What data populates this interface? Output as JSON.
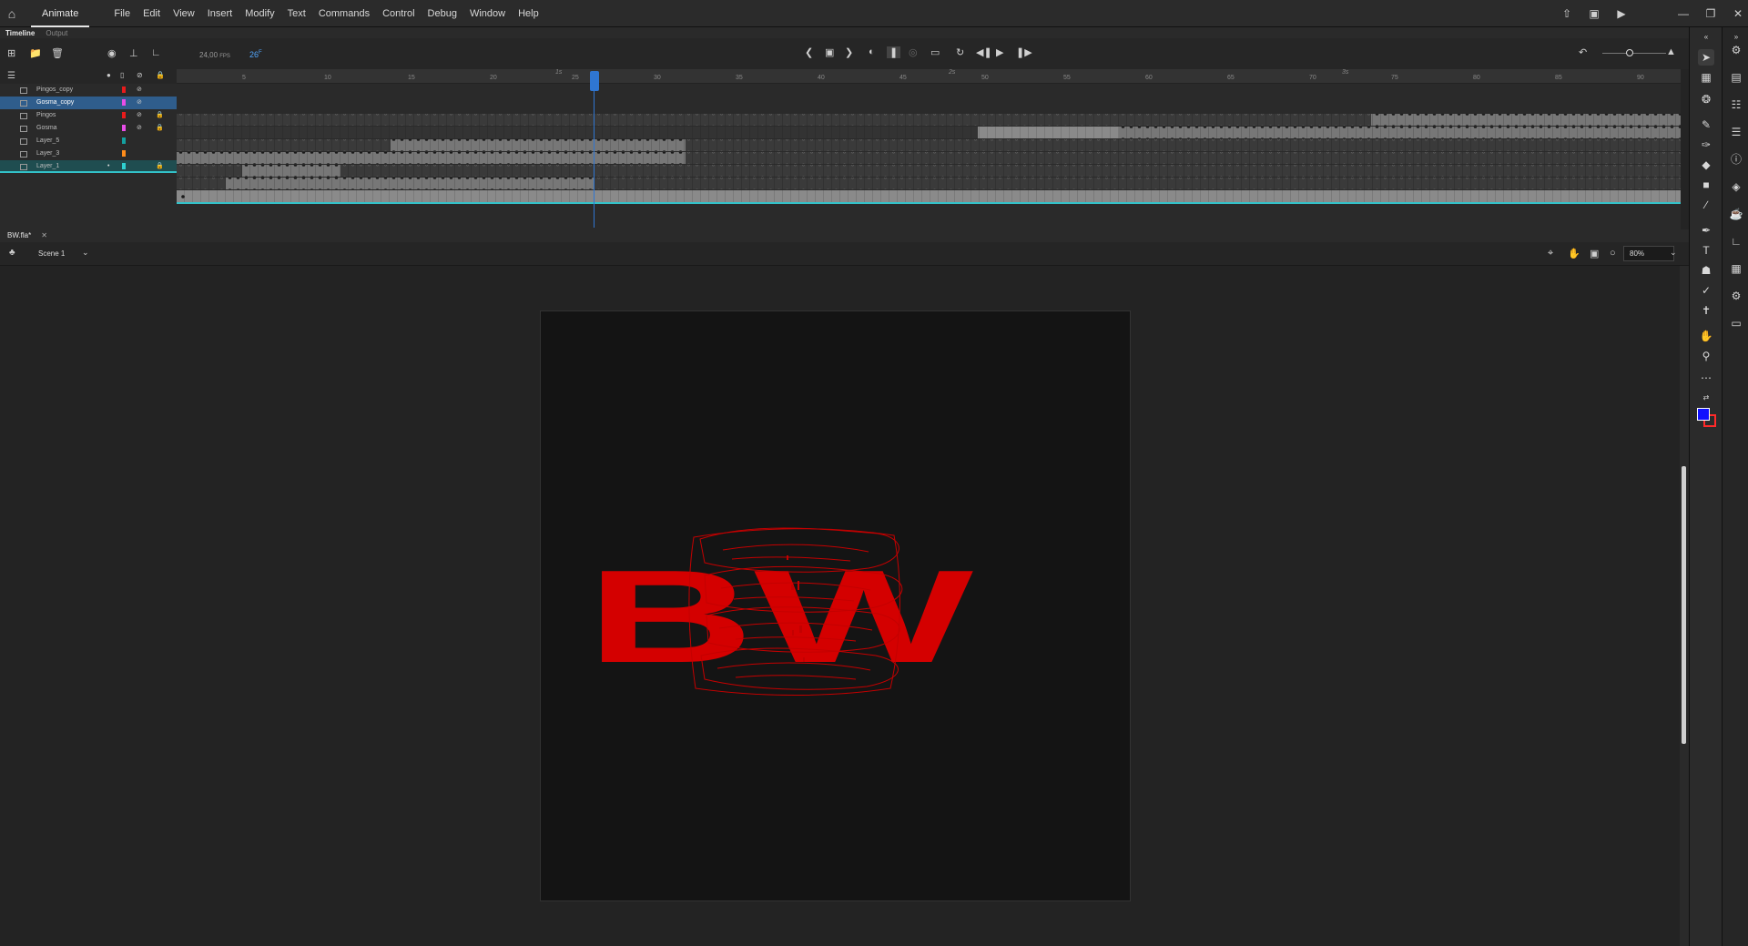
{
  "app": {
    "name": "Animate",
    "menus": [
      "File",
      "Edit",
      "View",
      "Insert",
      "Modify",
      "Text",
      "Commands",
      "Control",
      "Debug",
      "Window",
      "Help"
    ]
  },
  "timeline": {
    "tabs": [
      "Timeline",
      "Output"
    ],
    "fps": "24,00",
    "fps_unit": "FPS",
    "current_frame": "26",
    "frame_unit": "F",
    "ruler_labels": [
      "5",
      "10",
      "15",
      "20",
      "25",
      "30",
      "35",
      "40",
      "45",
      "50",
      "55",
      "60",
      "65",
      "70",
      "75",
      "80",
      "85",
      "90"
    ],
    "second_labels": [
      "1s",
      "2s",
      "3s"
    ],
    "layers": [
      {
        "name": "Pingos_copy",
        "color": "#e81b1b",
        "hidden": true,
        "locked": false
      },
      {
        "name": "Gosma_copy",
        "color": "#e84de8",
        "hidden": true,
        "locked": false
      },
      {
        "name": "Pingos",
        "color": "#e81b1b",
        "hidden": true,
        "locked": true
      },
      {
        "name": "Gosma",
        "color": "#e84de8",
        "hidden": true,
        "locked": true
      },
      {
        "name": "Layer_5",
        "color": "#14a0a0",
        "hidden": false,
        "locked": false
      },
      {
        "name": "Layer_3",
        "color": "#ff8c1a",
        "hidden": false,
        "locked": false
      },
      {
        "name": "Layer_1",
        "color": "#2fd0d0",
        "hidden": false,
        "locked": true
      }
    ]
  },
  "document": {
    "tab": "BW.fla*",
    "scene": "Scene 1",
    "zoom": "80%",
    "artwork_text": "BW",
    "artwork_color": "#d40000"
  },
  "tool_colors": {
    "fill": "#1010ff",
    "stroke": "#ff2a2a"
  }
}
